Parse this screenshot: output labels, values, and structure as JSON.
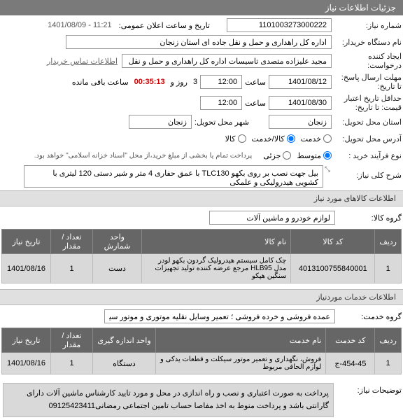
{
  "header": {
    "title": "جزئیات اطلاعات نیاز"
  },
  "fields": {
    "niaz_no_label": "شماره نیاز:",
    "niaz_no": "1101003273000222",
    "announce_label": "تاریخ و ساعت اعلان عمومی:",
    "announce_value": "1401/08/09 - 11:21",
    "buyer_label": "نام دستگاه خریدار:",
    "buyer_value": "اداره کل راهداری و حمل و نقل جاده ای استان زنجان",
    "requester_label": "ایجاد کننده درخواست:",
    "requester_value": "مجید علیزاده متصدی تاسیسات اداره کل راهداری و حمل و نقل جاده ای استان",
    "contact_link": "اطلاعات تماس خریدار",
    "deadline_label": "مهلت ارسال پاسخ: تا تاریخ:",
    "deadline_date": "1401/08/12",
    "time_label": "ساعت",
    "deadline_time": "12:00",
    "remain_prefix": "3",
    "remain_day_label": "روز و",
    "remain_timer": "00:35:13",
    "remain_suffix": "ساعت باقی مانده",
    "validity_label": "حداقل تاریخ اعتبار قیمت: تا تاریخ:",
    "validity_date": "1401/08/30",
    "validity_time": "12:00",
    "province_label": "استان محل تحویل:",
    "province_value": "زنجان",
    "city_label": "شهر محل تحویل:",
    "city_value": "زنجان",
    "delivery_addr_label": "آدرس محل تحویل:",
    "delivery_opts": {
      "opt1": "خدمت",
      "opt2": "کالا/خدمت",
      "opt3": "کالا"
    },
    "process_label": "نوع فرآیند خرید :",
    "process_opts": {
      "opt1": "متوسط",
      "opt2": "جزئی"
    },
    "process_note": "پرداخت تمام یا بخشی از مبلغ خرید،از محل \"اسناد خزانه اسلامی\" خواهد بود.",
    "desc_label": "شرح کلی نیاز:",
    "desc_value": "بیل جهت نصب بر روی بکهو TLC130 با عمق حفاری 4 متر و شیر دستی 120 لیتری با کشویی هیدرولیکی و علمکی"
  },
  "goods_section": {
    "title": "اطلاعات کالاهای مورد نیاز",
    "group_label": "گروه کالا:",
    "group_value": "لوازم خودرو و ماشین آلات",
    "table": {
      "headers": {
        "idx": "ردیف",
        "code": "کد کالا",
        "name": "نام کالا",
        "unit": "واحد شمارش",
        "qty": "تعداد / مقدار",
        "date": "تاریخ نیاز"
      },
      "rows": [
        {
          "idx": "1",
          "code": "4013100755840001",
          "name": "چک کامل سیستم هیدرولیک گردون بکهو لودر مدل HLB95 مرجع عرضه کننده تولید تجهیزات سنگین هپکو",
          "unit": "دست",
          "qty": "1",
          "date": "1401/08/16"
        }
      ]
    }
  },
  "services_section": {
    "title": "اطلاعات خدمات موردنیاز",
    "group_label": "گروه خدمت:",
    "group_value": "عمده فروشی و خرده فروشی ؛ تعمیر وسایل نقلیه موتوری و موتور سیکلت",
    "table": {
      "headers": {
        "idx": "ردیف",
        "code": "کد خدمت",
        "name": "نام خدمت",
        "unit": "واحد اندازه گیری",
        "qty": "تعداد / مقدار",
        "date": "تاریخ نیاز"
      },
      "rows": [
        {
          "idx": "1",
          "code": "454-45-ج",
          "name": "فروش، نگهداری و تعمیر موتور سیکلت و قطعات یدکی و لوازم الحاقی مربوط",
          "unit": "دستگاه",
          "qty": "1",
          "date": "1401/08/16"
        }
      ]
    }
  },
  "notes_section": {
    "label": "توضیحات نیاز:",
    "text": "پرداخت به صورت اعتباری و نصب و راه اندازی در محل و مورد تایید کارشناس ماشین آلات دارای گارانتی باشد و پرداخت منوط به اخذ مفاصا حساب تامین اجتماعی رمضانی09125423411"
  }
}
